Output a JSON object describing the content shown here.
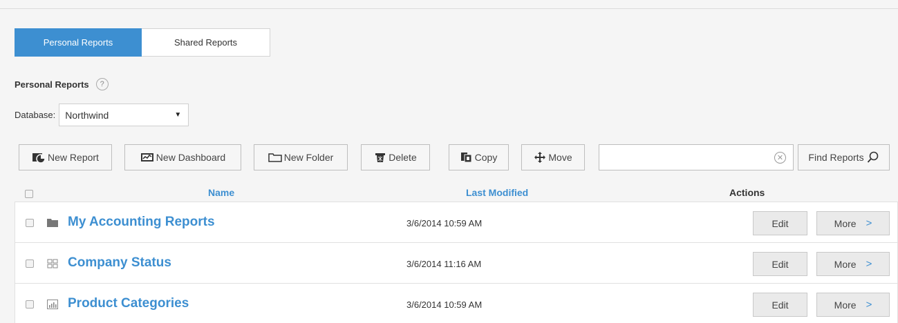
{
  "tabs": [
    {
      "label": "Personal Reports",
      "active": true
    },
    {
      "label": "Shared Reports",
      "active": false
    }
  ],
  "section": {
    "title": "Personal Reports",
    "help": "?"
  },
  "database": {
    "label": "Database:",
    "value": "Northwind"
  },
  "toolbar": {
    "new_report": "New Report",
    "new_dashboard": "New Dashboard",
    "new_folder": "New Folder",
    "delete": "Delete",
    "copy": "Copy",
    "move": "Move",
    "search_value": "",
    "find_reports": "Find Reports"
  },
  "table": {
    "columns": {
      "name": "Name",
      "last_modified": "Last Modified",
      "actions": "Actions"
    },
    "rows": [
      {
        "icon": "folder-icon",
        "name": "My Accounting Reports",
        "modified": "3/6/2014 10:59 AM",
        "edit": "Edit",
        "more": "More"
      },
      {
        "icon": "dashboard-icon",
        "name": "Company Status",
        "modified": "3/6/2014 11:16 AM",
        "edit": "Edit",
        "more": "More"
      },
      {
        "icon": "report-icon",
        "name": "Product Categories",
        "modified": "3/6/2014 10:59 AM",
        "edit": "Edit",
        "more": "More"
      }
    ]
  },
  "colors": {
    "accent": "#3d8fd1",
    "background": "#f5f5f5"
  }
}
